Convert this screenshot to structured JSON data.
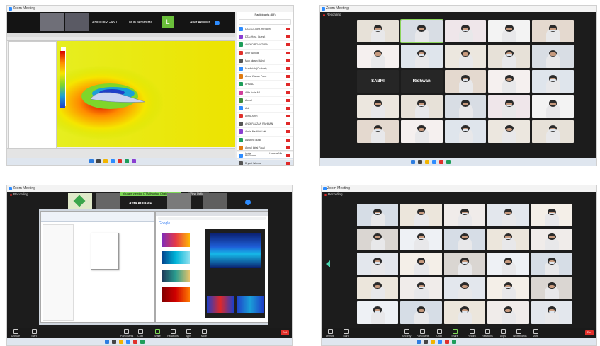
{
  "panels": {
    "top_left": {
      "window_title": "Zoom Meeting",
      "speakers": [
        {
          "name": "ANDI DIRGANT..."
        },
        {
          "name": "Muh akram Ma..."
        },
        {
          "name": "L"
        },
        {
          "name": "Arief Akhdiat"
        }
      ],
      "participants_header": "Participants (89)",
      "participants": [
        {
          "name": "DTA (Co-host, me) abn",
          "color": "#2d8cff"
        },
        {
          "name": "DTA (Host, Guest)",
          "color": "#8a3fd1"
        },
        {
          "name": "ANDI DIRGANTARA",
          "color": "#1e9e5a"
        },
        {
          "name": "Arief Akhdiat",
          "color": "#e0302b"
        },
        {
          "name": "Muh akram Mahdi",
          "color": "#555555"
        },
        {
          "name": "Nurdiniah (Co-host)",
          "color": "#2d8cff"
        },
        {
          "name": "Abdul Wahab Putra",
          "color": "#e07a10"
        },
        {
          "name": "AHMAD",
          "color": "#1e9e5a"
        },
        {
          "name": "Afifa Aulia AP",
          "color": "#d13f9a"
        },
        {
          "name": "Akmal",
          "color": "#3d8a3d"
        },
        {
          "name": "Aldi",
          "color": "#2d8cff"
        },
        {
          "name": "Alif Al Amin",
          "color": "#e0302b"
        },
        {
          "name": "ANDI FAUZAN RAHMAN",
          "color": "#555555"
        },
        {
          "name": "Annis Naafilah Lutfi",
          "color": "#8a3fd1"
        },
        {
          "name": "Ashwini Taufik",
          "color": "#1e9e5a"
        },
        {
          "name": "Akmal Iqbal Fauzi",
          "color": "#e07a10"
        },
        {
          "name": "Bill Dunia",
          "color": "#2d8cff"
        },
        {
          "name": "Bryant Wanda",
          "color": "#555555"
        }
      ],
      "participant_footer": [
        "Invite",
        "Unmute Me"
      ]
    },
    "top_right": {
      "window_title": "Zoom Meeting",
      "recording": "Recording",
      "name_tiles": [
        "SABRI",
        "Ridhwan"
      ]
    },
    "bottom_left": {
      "window_title": "Zoom Meeting",
      "recording": "Recording",
      "share_notice": "You are viewing DTA (Kontrol Chat)'s screen",
      "view_options": "View Options",
      "thumb_name": "Afifa Aulia AP",
      "browser_search": "Google",
      "controls": [
        "Unmute",
        "Start Video",
        "Participants",
        "Chat",
        "Share Screen",
        "Reactions",
        "Apps",
        "More"
      ],
      "end": "End"
    },
    "bottom_right": {
      "window_title": "Zoom Meeting",
      "recording": "Recording",
      "controls": [
        "Unmute",
        "Start Video",
        "Security",
        "Participants",
        "Chat",
        "Share Screen",
        "Record",
        "Reactions",
        "Apps",
        "Whiteboards",
        "More"
      ],
      "end": "End"
    }
  }
}
